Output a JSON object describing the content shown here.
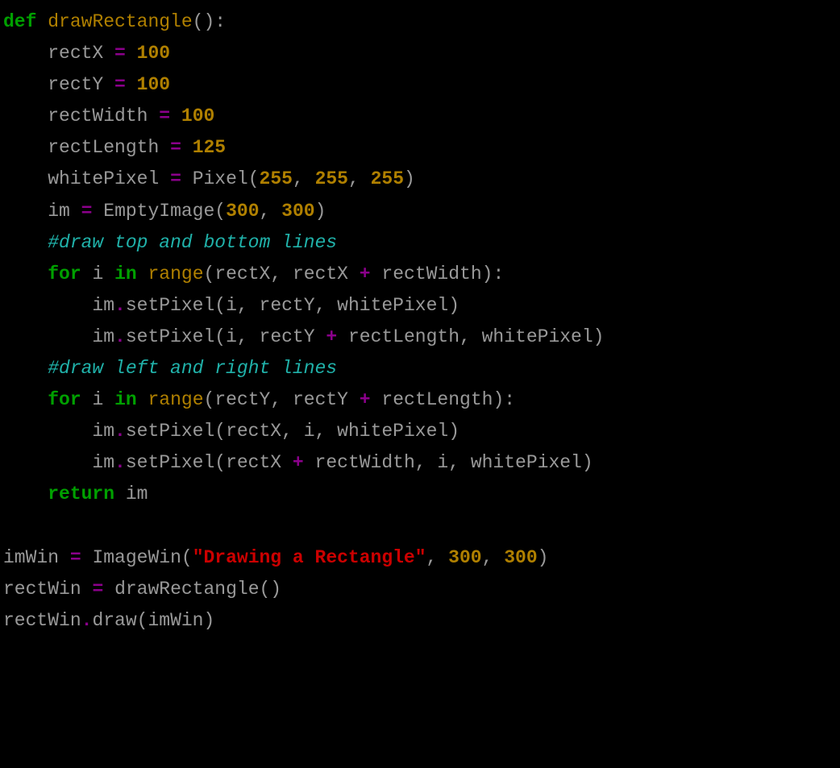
{
  "code": {
    "line1": {
      "def": "def",
      "name": "drawRectangle",
      "paren": "():"
    },
    "line2": {
      "var": "rectX",
      "eq": "=",
      "val": "100"
    },
    "line3": {
      "var": "rectY",
      "eq": "=",
      "val": "100"
    },
    "line4": {
      "var": "rectWidth",
      "eq": "=",
      "val": "100"
    },
    "line5": {
      "var": "rectLength",
      "eq": "=",
      "val": "125"
    },
    "line6": {
      "var": "whitePixel",
      "eq": "=",
      "call": "Pixel",
      "open": "(",
      "a1": "255",
      "c1": ",",
      "a2": "255",
      "c2": ",",
      "a3": "255",
      "close": ")"
    },
    "line7": {
      "var": "im",
      "eq": "=",
      "call": "EmptyImage",
      "open": "(",
      "a1": "300",
      "c1": ",",
      "a2": "300",
      "close": ")"
    },
    "line8": {
      "text": "#draw top and bottom lines"
    },
    "line9": {
      "for": "for",
      "i": "i",
      "in": "in",
      "range": "range",
      "open": "(",
      "a1": "rectX",
      "c1": ",",
      "a2": "rectX",
      "plus": "+",
      "a3": "rectWidth",
      "close": "):"
    },
    "line10": {
      "obj": "im",
      "dot": ".",
      "method": "setPixel",
      "open": "(",
      "a1": "i",
      "c1": ",",
      "a2": "rectY",
      "c2": ",",
      "a3": "whitePixel",
      "close": ")"
    },
    "line11": {
      "obj": "im",
      "dot": ".",
      "method": "setPixel",
      "open": "(",
      "a1": "i",
      "c1": ",",
      "a2": "rectY",
      "plus": "+",
      "a3": "rectLength",
      "c2": ",",
      "a4": "whitePixel",
      "close": ")"
    },
    "line12": {
      "text": "#draw left and right lines"
    },
    "line13": {
      "for": "for",
      "i": "i",
      "in": "in",
      "range": "range",
      "open": "(",
      "a1": "rectY",
      "c1": ",",
      "a2": "rectY",
      "plus": "+",
      "a3": "rectLength",
      "close": "):"
    },
    "line14": {
      "obj": "im",
      "dot": ".",
      "method": "setPixel",
      "open": "(",
      "a1": "rectX",
      "c1": ",",
      "a2": "i",
      "c2": ",",
      "a3": "whitePixel",
      "close": ")"
    },
    "line15": {
      "obj": "im",
      "dot": ".",
      "method": "setPixel",
      "open": "(",
      "a1": "rectX",
      "plus": "+",
      "a2": "rectWidth",
      "c1": ",",
      "a3": "i",
      "c2": ",",
      "a4": "whitePixel",
      "close": ")"
    },
    "line16": {
      "ret": "return",
      "val": "im"
    },
    "line18": {
      "var": "imWin",
      "eq": "=",
      "call": "ImageWin",
      "open": "(",
      "str": "\"Drawing a Rectangle\"",
      "c1": ",",
      "a1": "300",
      "c2": ",",
      "a2": "300",
      "close": ")"
    },
    "line19": {
      "var": "rectWin",
      "eq": "=",
      "call": "drawRectangle",
      "paren": "()"
    },
    "line20": {
      "obj": "rectWin",
      "dot": ".",
      "method": "draw",
      "open": "(",
      "a1": "imWin",
      "close": ")"
    }
  }
}
